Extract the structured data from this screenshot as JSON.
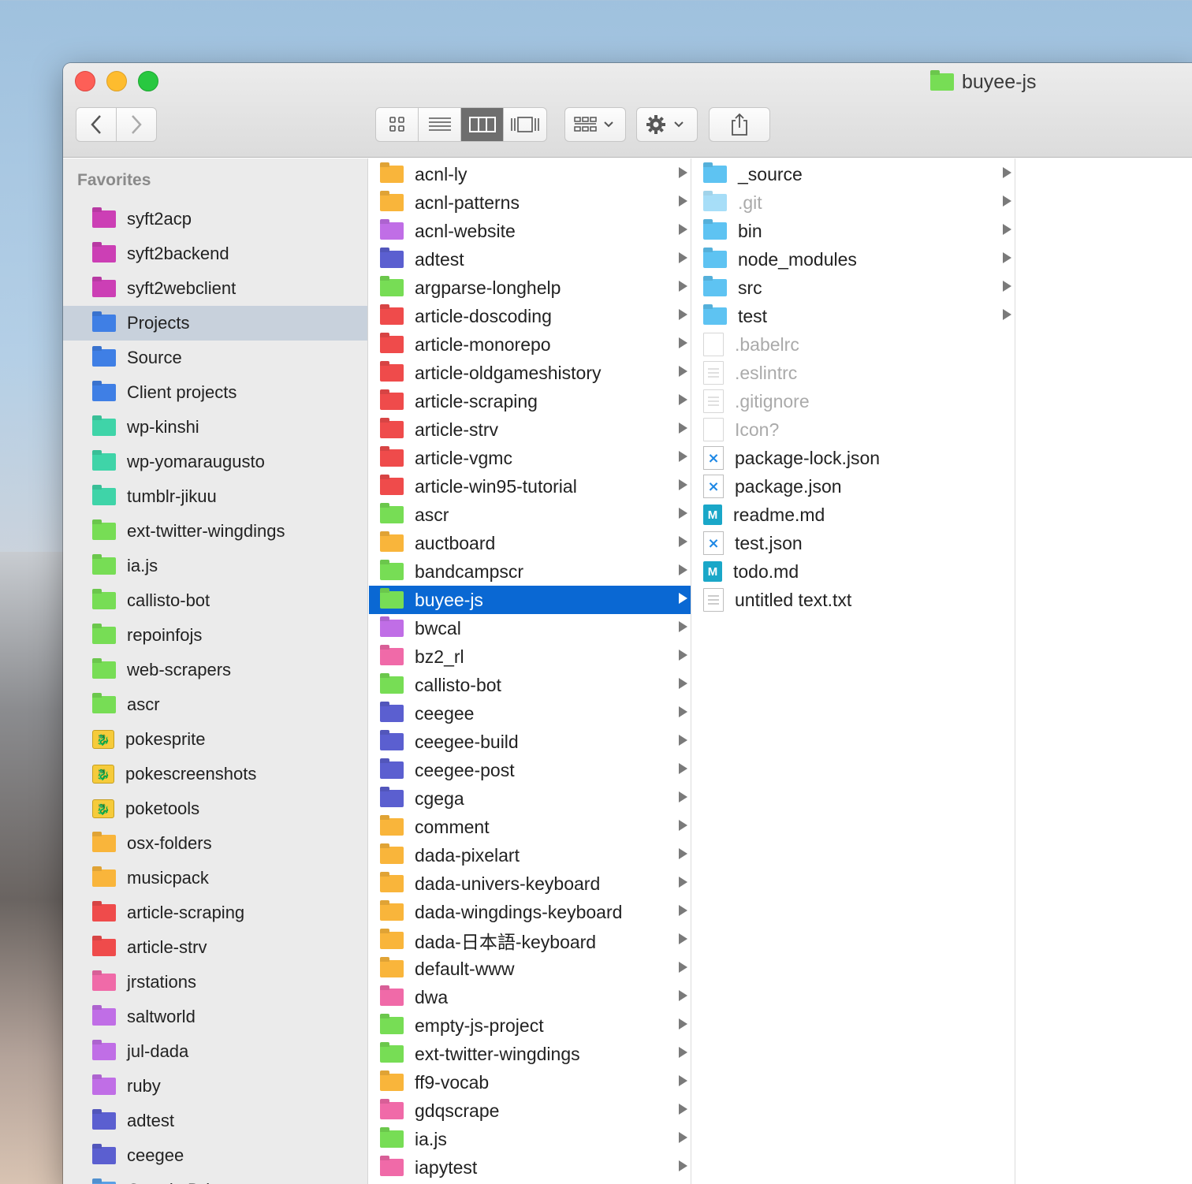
{
  "window": {
    "title": "buyee-js",
    "title_folder_color": "#77dd55"
  },
  "toolbar": {
    "back_icon": "chevron-left-icon",
    "forward_icon": "chevron-right-icon",
    "view_modes": [
      "icon-view",
      "list-view",
      "column-view",
      "gallery-view"
    ],
    "active_view": "column-view",
    "group_icon": "group-by-icon",
    "action_icon": "gear-icon",
    "share_icon": "share-icon"
  },
  "sidebar": {
    "heading": "Favorites",
    "items": [
      {
        "label": "syft2acp",
        "color": "#cc3fb5",
        "icon": "folder"
      },
      {
        "label": "syft2backend",
        "color": "#cc3fb5",
        "icon": "folder"
      },
      {
        "label": "syft2webclient",
        "color": "#cc3fb5",
        "icon": "folder"
      },
      {
        "label": "Projects",
        "color": "#3f7fe5",
        "icon": "folder",
        "selected": true
      },
      {
        "label": "Source",
        "color": "#3f7fe5",
        "icon": "folder"
      },
      {
        "label": "Client projects",
        "color": "#3f7fe5",
        "icon": "folder"
      },
      {
        "label": "wp-kinshi",
        "color": "#3fd4a8",
        "icon": "folder"
      },
      {
        "label": "wp-yomaraugusto",
        "color": "#3fd4a8",
        "icon": "folder"
      },
      {
        "label": "tumblr-jikuu",
        "color": "#3fd4a8",
        "icon": "folder"
      },
      {
        "label": "ext-twitter-wingdings",
        "color": "#77dd55",
        "icon": "folder"
      },
      {
        "label": "ia.js",
        "color": "#77dd55",
        "icon": "folder"
      },
      {
        "label": "callisto-bot",
        "color": "#77dd55",
        "icon": "folder"
      },
      {
        "label": "repoinfojs",
        "color": "#77dd55",
        "icon": "folder"
      },
      {
        "label": "web-scrapers",
        "color": "#77dd55",
        "icon": "folder"
      },
      {
        "label": "ascr",
        "color": "#77dd55",
        "icon": "folder"
      },
      {
        "label": "pokesprite",
        "color": "#f6cb3b",
        "icon": "poke"
      },
      {
        "label": "pokescreenshots",
        "color": "#f6cb3b",
        "icon": "poke"
      },
      {
        "label": "poketools",
        "color": "#f6cb3b",
        "icon": "poke"
      },
      {
        "label": "osx-folders",
        "color": "#f9b53b",
        "icon": "folder"
      },
      {
        "label": "musicpack",
        "color": "#f9b53b",
        "icon": "folder"
      },
      {
        "label": "article-scraping",
        "color": "#ef4b4b",
        "icon": "folder"
      },
      {
        "label": "article-strv",
        "color": "#ef4b4b",
        "icon": "folder"
      },
      {
        "label": "jrstations",
        "color": "#f06aa8",
        "icon": "folder"
      },
      {
        "label": "saltworld",
        "color": "#c06ee6",
        "icon": "folder"
      },
      {
        "label": "jul-dada",
        "color": "#c06ee6",
        "icon": "folder"
      },
      {
        "label": "ruby",
        "color": "#c06ee6",
        "icon": "folder"
      },
      {
        "label": "adtest",
        "color": "#5b5fd0",
        "icon": "folder"
      },
      {
        "label": "ceegee",
        "color": "#5b5fd0",
        "icon": "folder"
      },
      {
        "label": "Google Drive",
        "color": "#5aa0e6",
        "icon": "folder"
      }
    ]
  },
  "column1": {
    "items": [
      {
        "label": "acnl-ly",
        "color": "#f9b53b"
      },
      {
        "label": "acnl-patterns",
        "color": "#f9b53b"
      },
      {
        "label": "acnl-website",
        "color": "#c06ee6"
      },
      {
        "label": "adtest",
        "color": "#5b5fd0"
      },
      {
        "label": "argparse-longhelp",
        "color": "#77dd55"
      },
      {
        "label": "article-doscoding",
        "color": "#ef4b4b"
      },
      {
        "label": "article-monorepo",
        "color": "#ef4b4b"
      },
      {
        "label": "article-oldgameshistory",
        "color": "#ef4b4b"
      },
      {
        "label": "article-scraping",
        "color": "#ef4b4b"
      },
      {
        "label": "article-strv",
        "color": "#ef4b4b"
      },
      {
        "label": "article-vgmc",
        "color": "#ef4b4b"
      },
      {
        "label": "article-win95-tutorial",
        "color": "#ef4b4b"
      },
      {
        "label": "ascr",
        "color": "#77dd55"
      },
      {
        "label": "auctboard",
        "color": "#f9b53b"
      },
      {
        "label": "bandcampscr",
        "color": "#77dd55"
      },
      {
        "label": "buyee-js",
        "color": "#77dd55",
        "selected": true
      },
      {
        "label": "bwcal",
        "color": "#c06ee6"
      },
      {
        "label": "bz2_rl",
        "color": "#f06aa8"
      },
      {
        "label": "callisto-bot",
        "color": "#77dd55"
      },
      {
        "label": "ceegee",
        "color": "#5b5fd0"
      },
      {
        "label": "ceegee-build",
        "color": "#5b5fd0"
      },
      {
        "label": "ceegee-post",
        "color": "#5b5fd0"
      },
      {
        "label": "cgega",
        "color": "#5b5fd0"
      },
      {
        "label": "comment",
        "color": "#f9b53b"
      },
      {
        "label": "dada-pixelart",
        "color": "#f9b53b"
      },
      {
        "label": "dada-univers-keyboard",
        "color": "#f9b53b"
      },
      {
        "label": "dada-wingdings-keyboard",
        "color": "#f9b53b"
      },
      {
        "label": "dada-日本語-keyboard",
        "color": "#f9b53b"
      },
      {
        "label": "default-www",
        "color": "#f9b53b"
      },
      {
        "label": "dwa",
        "color": "#f06aa8"
      },
      {
        "label": "empty-js-project",
        "color": "#77dd55"
      },
      {
        "label": "ext-twitter-wingdings",
        "color": "#77dd55"
      },
      {
        "label": "ff9-vocab",
        "color": "#f9b53b"
      },
      {
        "label": "gdqscrape",
        "color": "#f06aa8"
      },
      {
        "label": "ia.js",
        "color": "#77dd55"
      },
      {
        "label": "iapytest",
        "color": "#f06aa8"
      }
    ]
  },
  "column2": {
    "items": [
      {
        "label": "_source",
        "type": "folder",
        "color": "#5ec3f2",
        "arrow": true
      },
      {
        "label": ".git",
        "type": "folder",
        "color": "#5ec3f2",
        "arrow": true,
        "dim": true
      },
      {
        "label": "bin",
        "type": "folder",
        "color": "#5ec3f2",
        "arrow": true
      },
      {
        "label": "node_modules",
        "type": "folder",
        "color": "#5ec3f2",
        "arrow": true
      },
      {
        "label": "src",
        "type": "folder",
        "color": "#5ec3f2",
        "arrow": true
      },
      {
        "label": "test",
        "type": "folder",
        "color": "#5ec3f2",
        "arrow": true
      },
      {
        "label": ".babelrc",
        "type": "file",
        "dim": true
      },
      {
        "label": ".eslintrc",
        "type": "text",
        "dim": true
      },
      {
        "label": ".gitignore",
        "type": "text",
        "dim": true
      },
      {
        "label": "Icon?",
        "type": "file",
        "dim": true
      },
      {
        "label": "package-lock.json",
        "type": "vscode"
      },
      {
        "label": "package.json",
        "type": "vscode"
      },
      {
        "label": "readme.md",
        "type": "md"
      },
      {
        "label": "test.json",
        "type": "vscode"
      },
      {
        "label": "todo.md",
        "type": "md"
      },
      {
        "label": "untitled text.txt",
        "type": "text"
      }
    ]
  },
  "icons": {
    "vscode_glyph": "⨯",
    "md_glyph": "M",
    "poke_glyph": "🐉"
  }
}
